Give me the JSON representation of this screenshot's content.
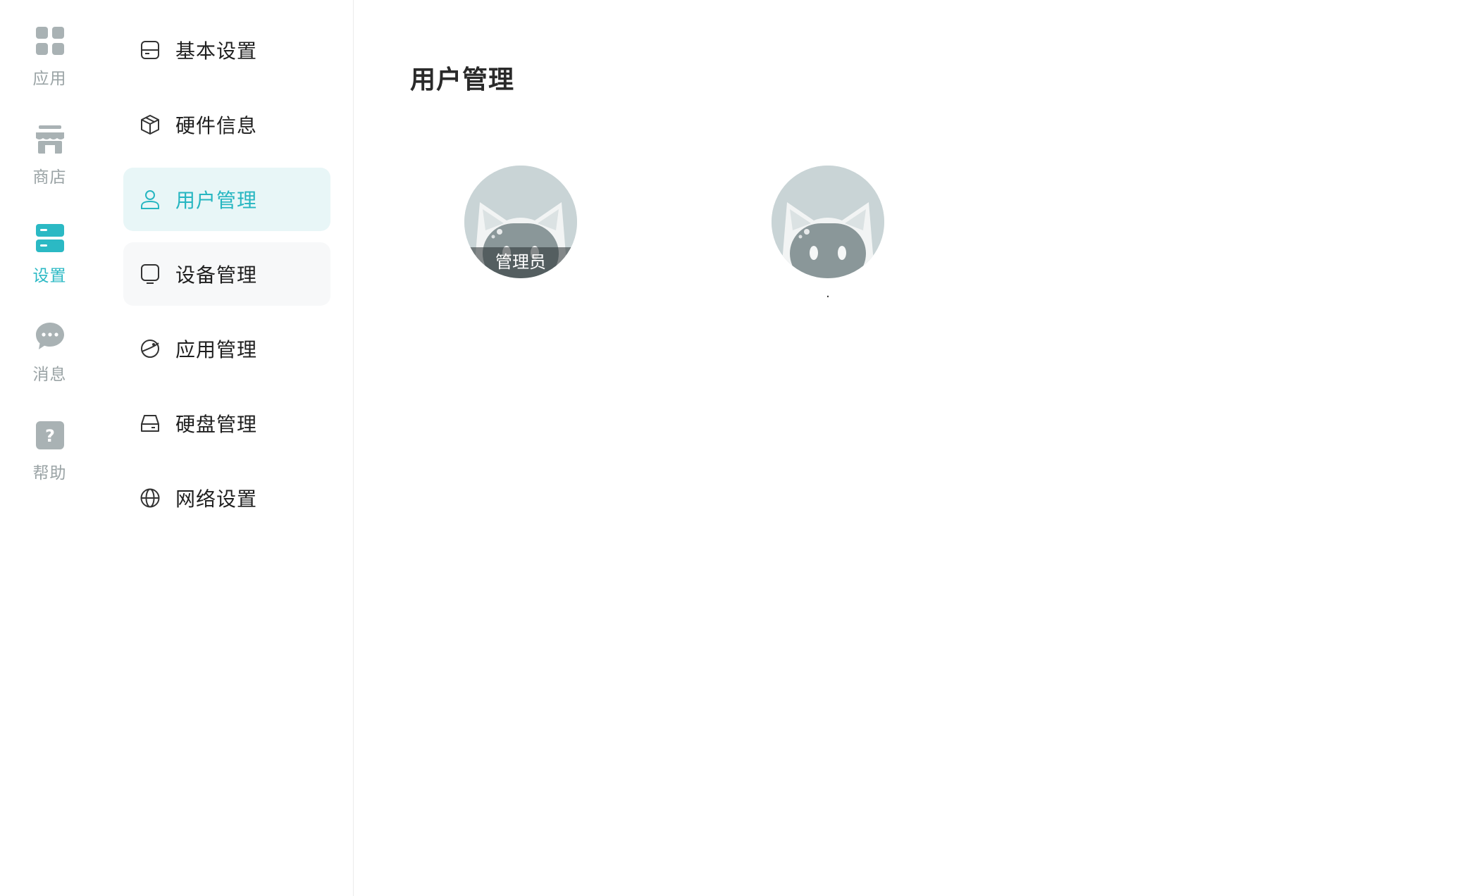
{
  "rail": {
    "items": [
      {
        "label": "应用",
        "icon": "grid-icon"
      },
      {
        "label": "商店",
        "icon": "store-icon"
      },
      {
        "label": "设置",
        "icon": "settings-server-icon",
        "active": true
      },
      {
        "label": "消息",
        "icon": "chat-bubble-icon"
      },
      {
        "label": "帮助",
        "icon": "help-icon"
      }
    ]
  },
  "sidebar": {
    "items": [
      {
        "label": "基本设置",
        "icon": "document-card-icon"
      },
      {
        "label": "硬件信息",
        "icon": "cube-icon"
      },
      {
        "label": "用户管理",
        "icon": "user-icon",
        "active": true
      },
      {
        "label": "设备管理",
        "icon": "tablet-icon"
      },
      {
        "label": "应用管理",
        "icon": "planet-icon"
      },
      {
        "label": "硬盘管理",
        "icon": "hard-drive-icon"
      },
      {
        "label": "网络设置",
        "icon": "globe-icon"
      }
    ]
  },
  "main": {
    "title": "用户管理",
    "users": [
      {
        "role": "管理员",
        "name": ""
      },
      {
        "role": "",
        "name": "."
      }
    ]
  },
  "colors": {
    "accent": "#2bb9c4",
    "active_bg": "#e8f6f7",
    "icon_gray": "#a9b2b4"
  }
}
